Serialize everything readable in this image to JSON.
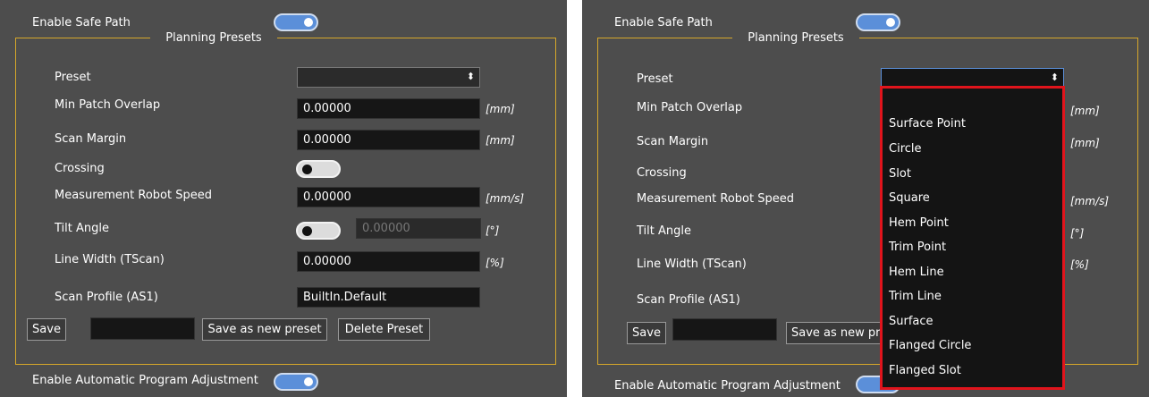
{
  "enable_safe_path": "Enable Safe Path",
  "planning_presets": "Planning Presets",
  "preset_label": "Preset",
  "min_patch_overlap": {
    "label": "Min Patch Overlap",
    "value": "0.00000",
    "unit": "[mm]"
  },
  "scan_margin": {
    "label": "Scan Margin",
    "value": "0.00000",
    "unit": "[mm]"
  },
  "crossing": "Crossing",
  "measurement_robot_speed": {
    "label": "Measurement Robot Speed",
    "value": "0.00000",
    "unit": "[mm/s]"
  },
  "tilt_angle": {
    "label": "Tilt Angle",
    "value": "0.00000",
    "unit": "[°]"
  },
  "line_width": {
    "label": "Line Width (TScan)",
    "value": "0.00000",
    "unit": "[%]"
  },
  "scan_profile": {
    "label": "Scan Profile (AS1)",
    "value": "BuiltIn.Default"
  },
  "buttons": {
    "save": "Save",
    "save_as_new": "Save as new preset",
    "save_as_new_truncated": "Save as new pr",
    "delete": "Delete Preset"
  },
  "enable_auto_adjust": "Enable Automatic Program Adjustment",
  "preset_options": [
    "Surface Point",
    "Circle",
    "Slot",
    "Square",
    "Hem Point",
    "Trim Point",
    "Hem Line",
    "Trim Line",
    "Surface",
    "Flanged Circle",
    "Flanged Slot"
  ],
  "colors": {
    "panel": "#4d4d4d",
    "accent_border": "#d6a72a",
    "toggle_on": "#5b8fd9",
    "highlight": "#e0141c"
  }
}
